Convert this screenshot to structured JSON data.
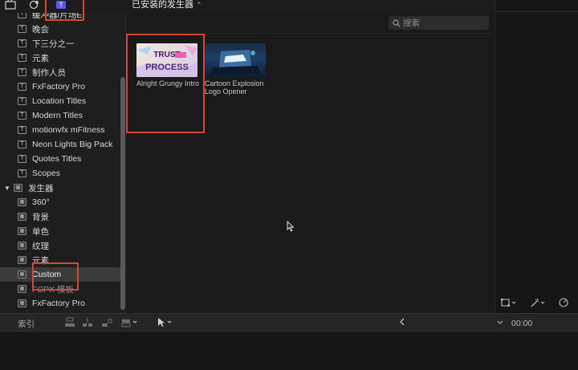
{
  "toolbar": {
    "icons": [
      "media-icon",
      "photos-icon",
      "titles-generators-icon"
    ]
  },
  "browser": {
    "title": "已安装的发生器",
    "search_placeholder": "搜索"
  },
  "sidebar": {
    "items": [
      {
        "label": "缓冲器/片场E",
        "kind": "title"
      },
      {
        "label": "晚会",
        "kind": "title"
      },
      {
        "label": "下三分之一",
        "kind": "title"
      },
      {
        "label": "元素",
        "kind": "title"
      },
      {
        "label": "制作人员",
        "kind": "title"
      },
      {
        "label": "FxFactory Pro",
        "kind": "title"
      },
      {
        "label": "Location Titles",
        "kind": "title"
      },
      {
        "label": "Modern Titles",
        "kind": "title"
      },
      {
        "label": "motionvfx mFitness",
        "kind": "title"
      },
      {
        "label": "Neon Lights Big Pack",
        "kind": "title"
      },
      {
        "label": "Quotes Titles",
        "kind": "title"
      },
      {
        "label": "Scopes",
        "kind": "title"
      },
      {
        "label": "发生器",
        "kind": "group"
      },
      {
        "label": "360°",
        "kind": "generator"
      },
      {
        "label": "背景",
        "kind": "generator"
      },
      {
        "label": "单色",
        "kind": "generator"
      },
      {
        "label": "纹理",
        "kind": "generator"
      },
      {
        "label": "元素",
        "kind": "generator"
      },
      {
        "label": "Custom",
        "kind": "generator",
        "selected": true
      },
      {
        "label": "FCPX 模板",
        "kind": "generator"
      },
      {
        "label": "FxFactory Pro",
        "kind": "generator"
      }
    ]
  },
  "clips": [
    {
      "name": "Alright Grungy Intro",
      "thumb_text": "TRUST THE PROCESS"
    },
    {
      "name": "Cartoon Explosion Logo Opener"
    }
  ],
  "bottom": {
    "index_label": "索引",
    "timecode": "00:00"
  },
  "colors": {
    "highlight": "#d8453b",
    "accent": "#6a66ff",
    "selected_row": "#3b3b3b"
  }
}
